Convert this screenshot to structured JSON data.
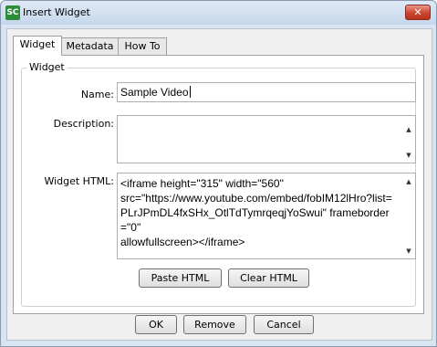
{
  "window": {
    "title": "Insert Widget",
    "app_icon_text": "SC",
    "close_glyph": "✕"
  },
  "tabs": [
    {
      "label": "Widget",
      "active": true
    },
    {
      "label": "Metadata",
      "active": false
    },
    {
      "label": "How To",
      "active": false
    }
  ],
  "group": {
    "legend": "Widget"
  },
  "fields": {
    "name": {
      "label": "Name:",
      "value": "Sample Video"
    },
    "description": {
      "label": "Description:",
      "value": ""
    },
    "widget_html": {
      "label": "Widget HTML:",
      "value": "<iframe height=\"315\" width=\"560\"\nsrc=\"https://www.youtube.com/embed/fobIM12lHro?list=PLrJPmDL4fxSHx_OtlTdTymrqeqjYoSwui\" frameborder=\"0\"\nallowfullscreen></iframe>"
    }
  },
  "buttons": {
    "paste_html": "Paste HTML",
    "clear_html": "Clear HTML",
    "ok": "OK",
    "remove": "Remove",
    "cancel": "Cancel"
  },
  "icons": {
    "scroll_up": "▲",
    "scroll_down": "▼"
  }
}
